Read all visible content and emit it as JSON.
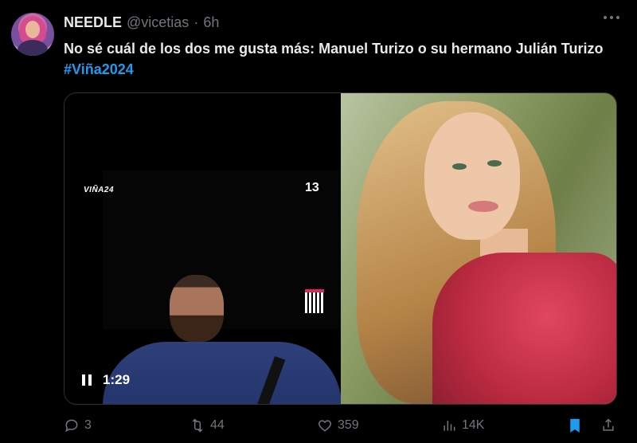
{
  "post": {
    "author_name": "NEEDLE",
    "handle": "@vicetias",
    "separator": "·",
    "time": "6h",
    "text": "No sé cuál de los dos me gusta más: Manuel Turizo o su hermano Julián Turizo",
    "hashtag": "#Viña2024"
  },
  "media": {
    "video_overlay_left": "VIÑA24",
    "video_overlay_channel": "13",
    "video_time": "1:29"
  },
  "actions": {
    "replies": "3",
    "reposts": "44",
    "likes": "359",
    "views": "14K"
  },
  "icons": [
    "more-icon",
    "reply-icon",
    "retweet-icon",
    "heart-icon",
    "views-icon",
    "bookmark-icon",
    "share-icon",
    "pause-icon"
  ],
  "colors": {
    "accent": "#1d9bf0",
    "muted": "#71767b",
    "background": "#000000"
  }
}
